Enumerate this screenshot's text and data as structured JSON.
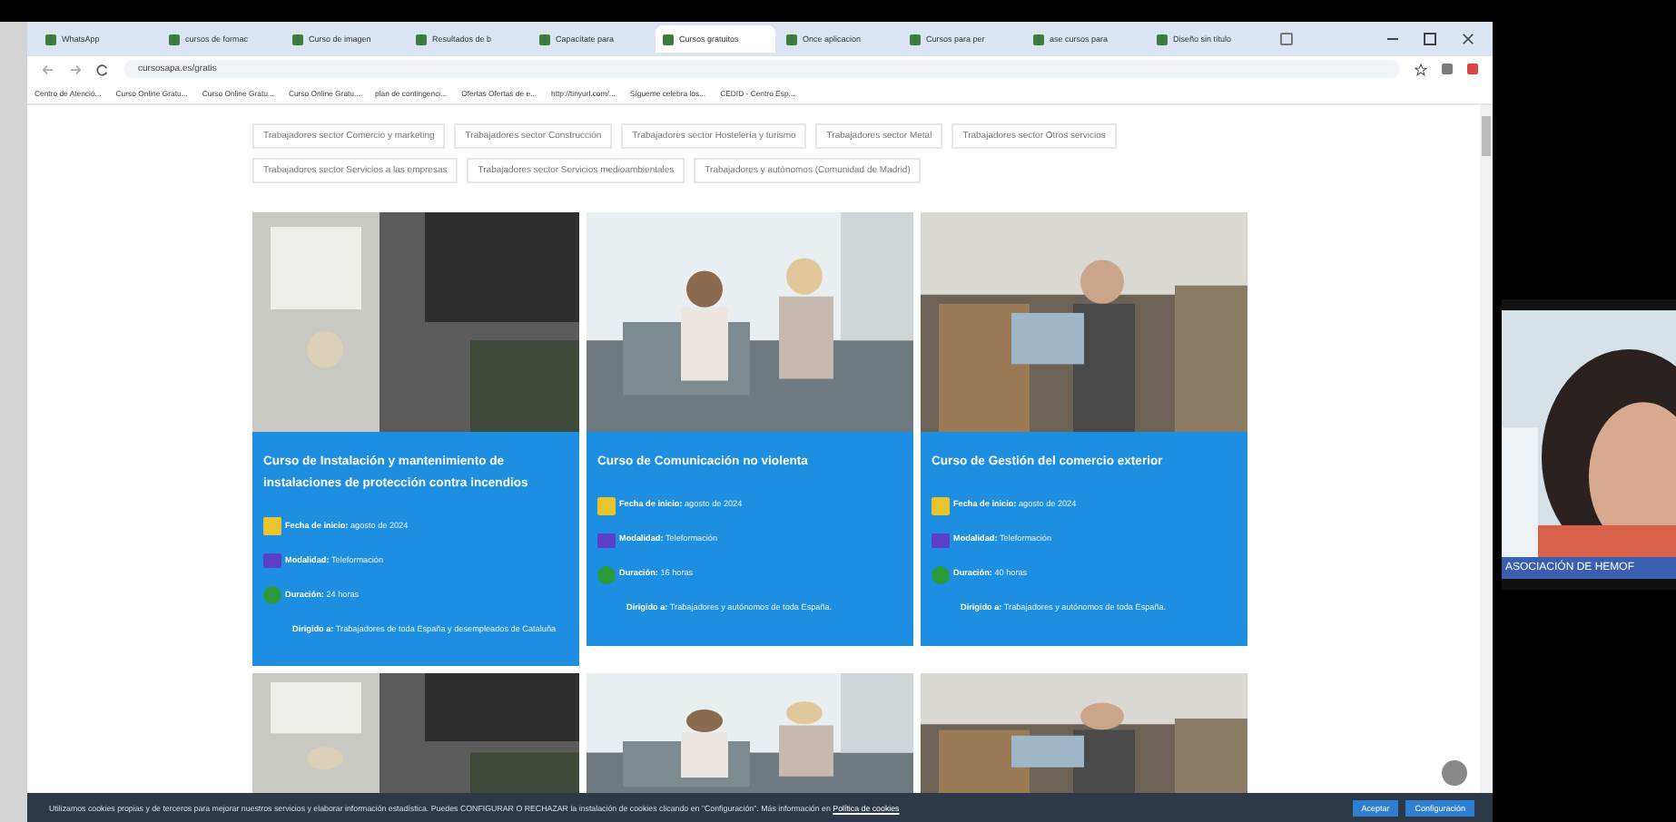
{
  "browser": {
    "tabs": [
      {
        "title": "WhatsApp",
        "selected": false
      },
      {
        "title": "cursos de formac",
        "selected": false
      },
      {
        "title": "Curso de imagen",
        "selected": false
      },
      {
        "title": "Resultados de b",
        "selected": false
      },
      {
        "title": "Capacítate para",
        "selected": false
      },
      {
        "title": "Cursos gratuitos",
        "selected": true
      },
      {
        "title": "Once aplicacion",
        "selected": false
      },
      {
        "title": "Cursos para per",
        "selected": false
      },
      {
        "title": "ase cursos para",
        "selected": false
      },
      {
        "title": "Diseño sin título",
        "selected": false
      }
    ],
    "url": "cursosapa.es/gratis",
    "bookmarks": [
      "Centro de Atenció...",
      "Curso Online Gratu...",
      "Curso Online Gratu...",
      "Curso Online Gratu...",
      "plan de contingenci...",
      "Ofertas Ofertas de e...",
      "http://tinyurl.com/...",
      "Sígueme celebra los...",
      "CEDID - Centro Esp..."
    ]
  },
  "filters": [
    "Trabajadores sector Comercio y marketing",
    "Trabajadores sector Construcción",
    "Trabajadores sector Hostelería y turismo",
    "Trabajadores sector Metal",
    "Trabajadores sector Otros servicios",
    "Trabajadores sector Servicios a las empresas",
    "Trabajadores sector Servicios medioambientales",
    "Trabajadores y autónomos (Comunidad de Madrid)"
  ],
  "courses": [
    {
      "title": "Curso de Instalación y mantenimiento de instalaciones de protección contra incendios",
      "fields": [
        {
          "kind": "date",
          "label": "Fecha de inicio:",
          "value": "agosto de 2024"
        },
        {
          "kind": "mode",
          "label": "Modalidad:",
          "value": "Teleformación"
        },
        {
          "kind": "duration",
          "label": "Duración:",
          "value": "24 horas"
        },
        {
          "kind": "audience",
          "label": "Dirigido a:",
          "value": "Trabajadores de toda España y desempleados de Cataluña"
        }
      ]
    },
    {
      "title": "Curso de Comunicación no violenta",
      "fields": [
        {
          "kind": "date",
          "label": "Fecha de inicio:",
          "value": "agosto de 2024"
        },
        {
          "kind": "mode",
          "label": "Modalidad:",
          "value": "Teleformación"
        },
        {
          "kind": "duration",
          "label": "Duración:",
          "value": "16 horas"
        },
        {
          "kind": "audience",
          "label": "Dirigido a:",
          "value": "Trabajadores y autónomos de toda España."
        }
      ]
    },
    {
      "title": "Curso de Gestión del comercio exterior",
      "fields": [
        {
          "kind": "date",
          "label": "Fecha de inicio:",
          "value": "agosto de 2024"
        },
        {
          "kind": "mode",
          "label": "Modalidad:",
          "value": "Teleformación"
        },
        {
          "kind": "duration",
          "label": "Duración:",
          "value": "40 horas"
        },
        {
          "kind": "audience",
          "label": "Dirigido a:",
          "value": "Trabajadores y autónomos de toda España."
        }
      ]
    }
  ],
  "cookie_banner": {
    "text": "Utilizamos cookies propias y de terceros para mejorar nuestros servicios y elaborar información estadística. Puedes CONFIGURAR O RECHAZAR la instalación de cookies clicando en \"Configuración\". Más información en",
    "link": "Política de cookies",
    "buttons": [
      "Aceptar",
      "Configuración"
    ]
  },
  "video_tile": {
    "caption": "ASOCIACIÓN DE HEMOF"
  }
}
